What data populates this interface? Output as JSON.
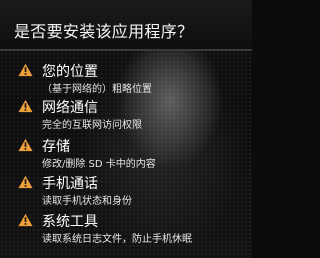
{
  "dialog": {
    "title": "是否要安装该应用程序？"
  },
  "permissions": [
    {
      "icon": "warning-icon",
      "name": "您的位置",
      "desc": "（基于网络的）粗略位置"
    },
    {
      "icon": "warning-icon",
      "name": "网络通信",
      "desc": "完全的互联网访问权限"
    },
    {
      "icon": "warning-icon",
      "name": "存储",
      "desc": "修改/删除 SD 卡中的内容"
    },
    {
      "icon": "warning-icon",
      "name": "手机通话",
      "desc": "读取手机状态和身份"
    },
    {
      "icon": "warning-icon",
      "name": "系统工具",
      "desc": "读取系统日志文件，防止手机休眠"
    }
  ],
  "colors": {
    "warning": "#f0a03a",
    "text": "#ffffff",
    "background": "#0b0b0b"
  }
}
